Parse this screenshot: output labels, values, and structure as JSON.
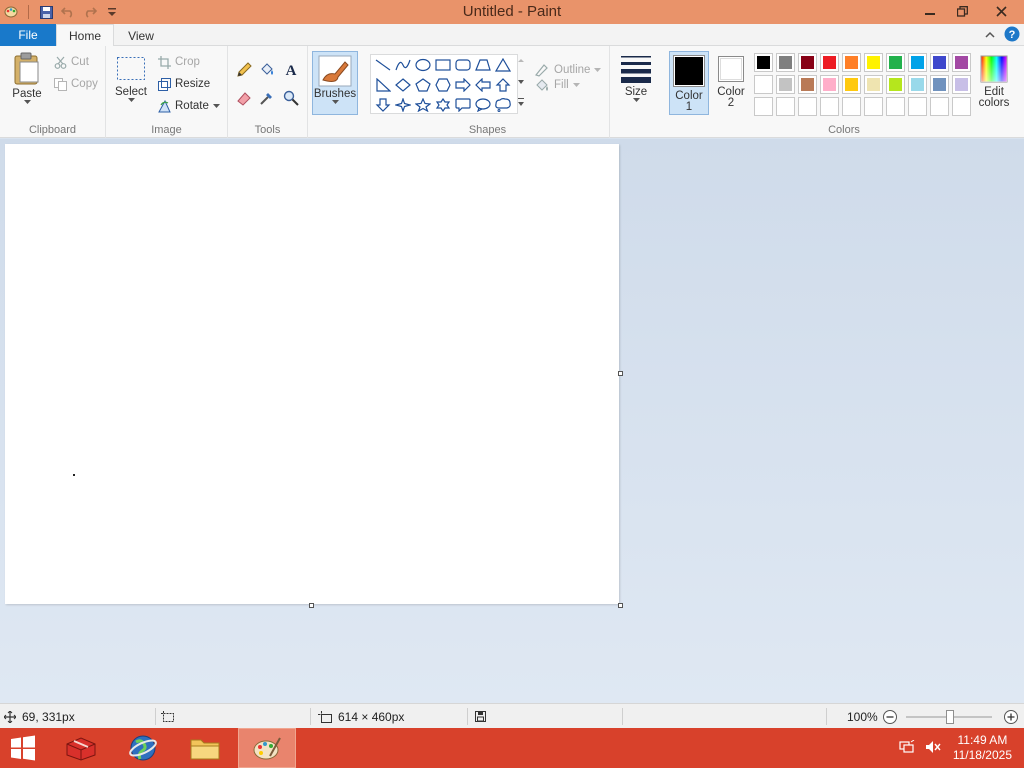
{
  "window": {
    "title": "Untitled - Paint"
  },
  "tabs": {
    "file": "File",
    "home": "Home",
    "view": "View"
  },
  "clipboard": {
    "label": "Clipboard",
    "paste": "Paste",
    "cut": "Cut",
    "copy": "Copy"
  },
  "image": {
    "label": "Image",
    "select": "Select",
    "crop": "Crop",
    "resize": "Resize",
    "rotate": "Rotate"
  },
  "tools": {
    "label": "Tools"
  },
  "brushes": {
    "label": "Brushes"
  },
  "shapes": {
    "label": "Shapes",
    "outline": "Outline",
    "fill": "Fill"
  },
  "size": {
    "label": "Size"
  },
  "colors": {
    "label": "Colors",
    "color1_label": "Color",
    "color1_num": "1",
    "color2_label": "Color",
    "color2_num": "2",
    "edit_line1": "Edit",
    "edit_line2": "colors",
    "color1_value": "#000000",
    "color2_value": "#ffffff",
    "palette_row1": [
      "#000000",
      "#7f7f7f",
      "#880015",
      "#ed1c24",
      "#ff7f27",
      "#fff200",
      "#22b14c",
      "#00a2e8",
      "#3f48cc",
      "#a349a4"
    ],
    "palette_row2": [
      "#ffffff",
      "#c3c3c3",
      "#b97a57",
      "#ffaec9",
      "#ffc90e",
      "#efe4b0",
      "#b5e61d",
      "#99d9ea",
      "#7092be",
      "#c8bfe7"
    ]
  },
  "status": {
    "cursor_pos": "69, 331px",
    "canvas_size": "614 × 460px",
    "zoom": "100%"
  },
  "taskbar": {
    "time": "11:49 AM",
    "date": "11/18/2025"
  }
}
